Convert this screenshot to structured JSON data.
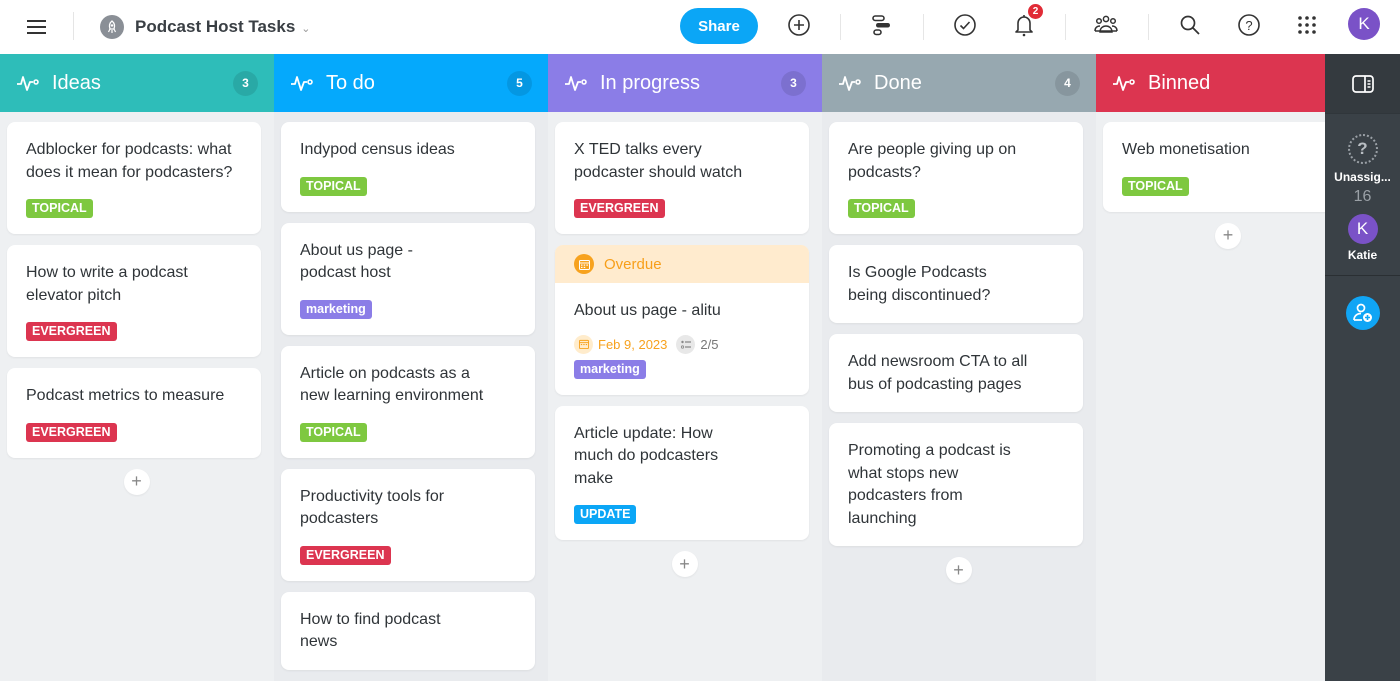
{
  "header": {
    "project_title": "Podcast Host Tasks",
    "share_label": "Share",
    "notification_count": "2",
    "user_initial": "K"
  },
  "colors": {
    "ideas": "#2ebdb9",
    "todo": "#05a9fc",
    "in_progress": "#8b7de7",
    "done": "#97a8b0",
    "binned": "#dc3550",
    "topical": "#7ec840",
    "evergreen": "#dc3550",
    "marketing": "#8b7de7",
    "update": "#0ba6f6",
    "overdue": "#f7a21e"
  },
  "columns": [
    {
      "title": "Ideas",
      "count": "3",
      "cards": [
        {
          "title": "Adblocker for podcasts: what does it mean for podcasters?",
          "tag": "TOPICAL"
        },
        {
          "title": "How to write a podcast elevator pitch",
          "tag": "EVERGREEN"
        },
        {
          "title": "Podcast metrics to measure",
          "tag": "EVERGREEN"
        }
      ]
    },
    {
      "title": "To do",
      "count": "5",
      "cards": [
        {
          "title": "Indypod census ideas",
          "tag": "TOPICAL"
        },
        {
          "title": "About us page - podcast host",
          "tag": "marketing"
        },
        {
          "title": "Article on podcasts as a new learning environment",
          "tag": "TOPICAL"
        },
        {
          "title": "Productivity tools for podcasters",
          "tag": "EVERGREEN"
        },
        {
          "title": "How to find podcast news"
        }
      ]
    },
    {
      "title": "In progress",
      "count": "3",
      "cards": [
        {
          "title": "X TED talks every podcaster should watch",
          "tag": "EVERGREEN"
        },
        {
          "status": "Overdue",
          "title": "About us page - alitu",
          "due_date": "Feb 9, 2023",
          "checklist": "2/5",
          "tag": "marketing"
        },
        {
          "title": "Article update: How much do podcasters make",
          "tag": "UPDATE"
        }
      ]
    },
    {
      "title": "Done",
      "count": "4",
      "cards": [
        {
          "title": "Are people giving up on podcasts?",
          "tag": "TOPICAL"
        },
        {
          "title": "Is Google Podcasts being discontinued?"
        },
        {
          "title": "Add newsroom CTA to all bus of podcasting pages"
        },
        {
          "title": "Promoting a podcast is what stops new podcasters from launching"
        }
      ]
    },
    {
      "title": "Binned",
      "cards": [
        {
          "title": "Web monetisation",
          "tag": "TOPICAL"
        }
      ]
    }
  ],
  "sidebar": {
    "unassigned_label": "Unassig...",
    "unassigned_count": "16",
    "assignee_name": "Katie",
    "assignee_initial": "K"
  }
}
